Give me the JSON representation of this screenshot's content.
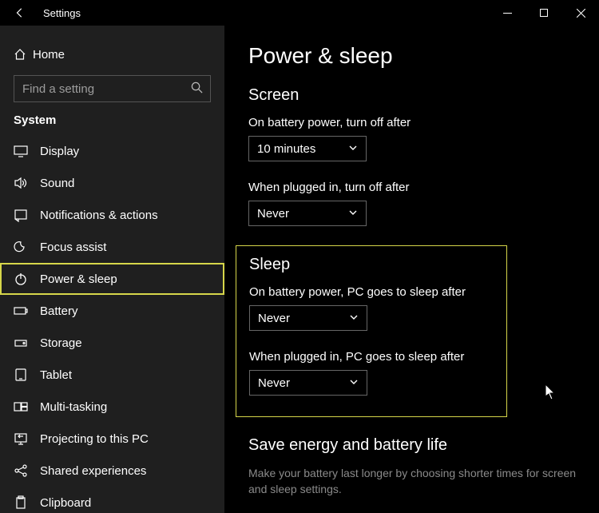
{
  "window": {
    "title": "Settings"
  },
  "sidebar": {
    "home_label": "Home",
    "search_placeholder": "Find a setting",
    "group_title": "System",
    "items": [
      {
        "icon": "display-icon",
        "label": "Display"
      },
      {
        "icon": "sound-icon",
        "label": "Sound"
      },
      {
        "icon": "notifications-icon",
        "label": "Notifications & actions"
      },
      {
        "icon": "focus-icon",
        "label": "Focus assist"
      },
      {
        "icon": "power-icon",
        "label": "Power & sleep"
      },
      {
        "icon": "battery-icon",
        "label": "Battery"
      },
      {
        "icon": "storage-icon",
        "label": "Storage"
      },
      {
        "icon": "tablet-icon",
        "label": "Tablet"
      },
      {
        "icon": "multitask-icon",
        "label": "Multi-tasking"
      },
      {
        "icon": "projecting-icon",
        "label": "Projecting to this PC"
      },
      {
        "icon": "shared-icon",
        "label": "Shared experiences"
      },
      {
        "icon": "clipboard-icon",
        "label": "Clipboard"
      }
    ],
    "selected_index": 4
  },
  "page": {
    "title": "Power & sleep",
    "screen_section": "Screen",
    "screen_battery_label": "On battery power, turn off after",
    "screen_battery_value": "10 minutes",
    "screen_plugged_label": "When plugged in, turn off after",
    "screen_plugged_value": "Never",
    "sleep_section": "Sleep",
    "sleep_battery_label": "On battery power, PC goes to sleep after",
    "sleep_battery_value": "Never",
    "sleep_plugged_label": "When plugged in, PC goes to sleep after",
    "sleep_plugged_value": "Never",
    "save_section": "Save energy and battery life",
    "save_tip": "Make your battery last longer by choosing shorter times for screen and sleep settings."
  }
}
